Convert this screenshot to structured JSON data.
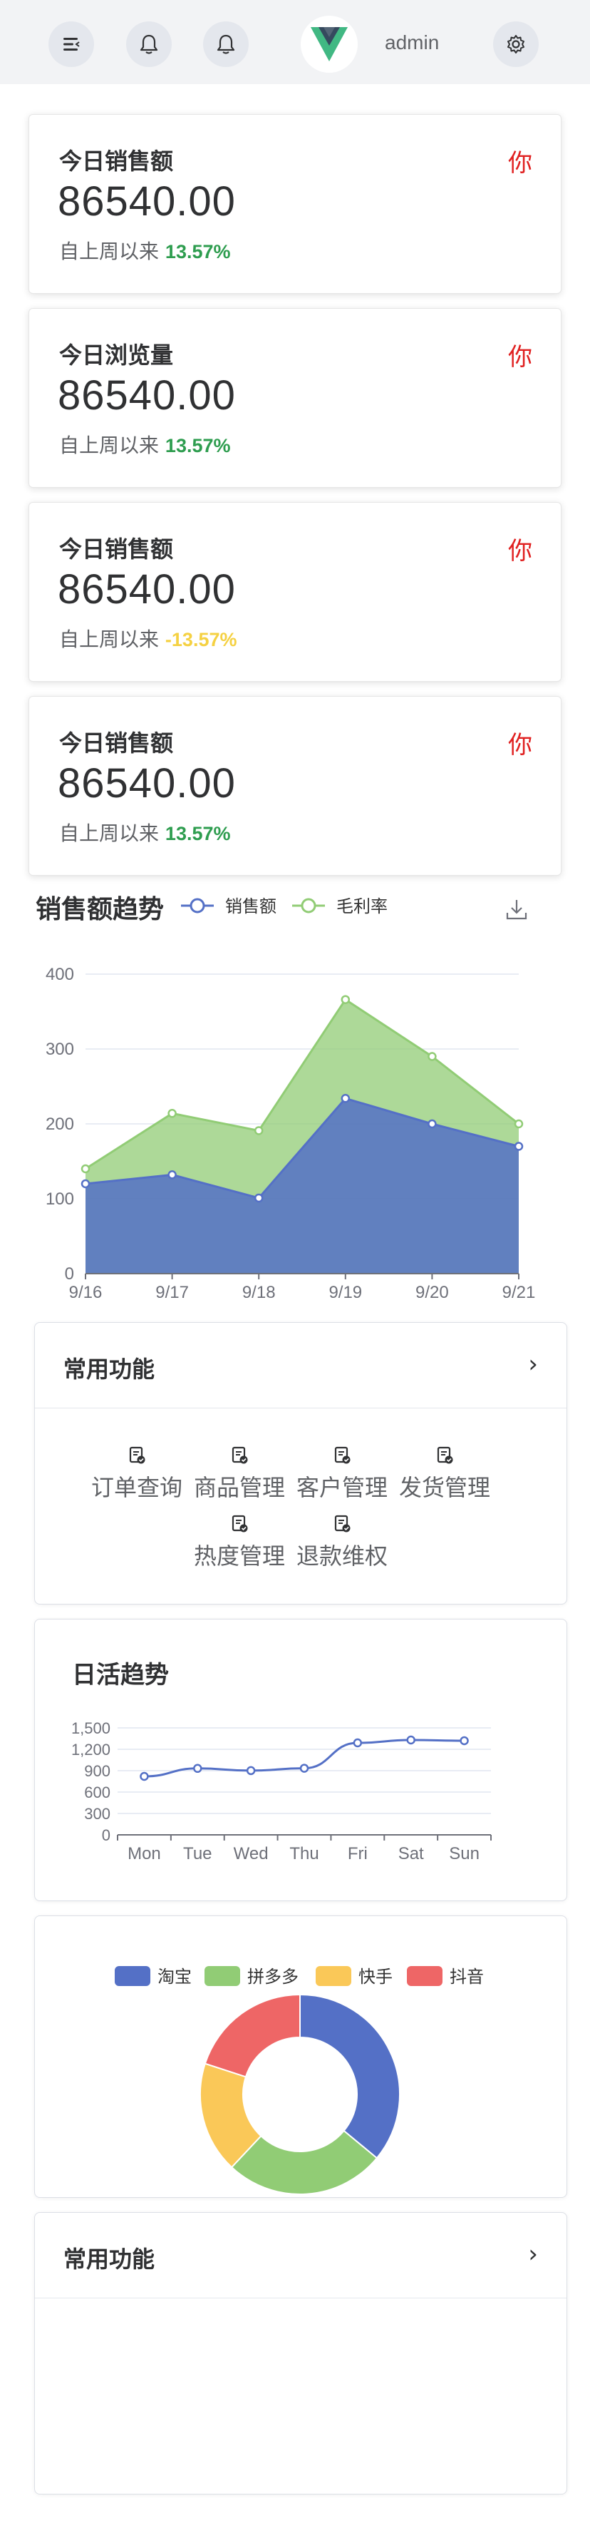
{
  "topbar": {
    "username": "admin",
    "icons": [
      "menu-icon",
      "bell-icon",
      "bell-icon",
      "vue-logo",
      "gear-icon"
    ]
  },
  "stat_cards": [
    {
      "title": "今日销售额",
      "corner": "你",
      "value": "86540.00",
      "sub_label": "自上周以来",
      "pct": "13.57%",
      "pct_color": "#2e9d4f"
    },
    {
      "title": "今日浏览量",
      "corner": "你",
      "value": "86540.00",
      "sub_label": "自上周以来",
      "pct": "13.57%",
      "pct_color": "#2e9d4f"
    },
    {
      "title": "今日销售额",
      "corner": "你",
      "value": "86540.00",
      "sub_label": "自上周以来",
      "pct": "-13.57%",
      "pct_color": "#f5d142"
    },
    {
      "title": "今日销售额",
      "corner": "你",
      "value": "86540.00",
      "sub_label": "自上周以来",
      "pct": "13.57%",
      "pct_color": "#2e9d4f"
    }
  ],
  "sales_trend": {
    "title": "销售额趋势"
  },
  "common_functions": {
    "title": "常用功能",
    "items": [
      "订单查询",
      "商品管理",
      "客户管理",
      "发货管理",
      "热度管理",
      "退款维权"
    ]
  },
  "daily_active": {
    "title": "日活趋势"
  },
  "common_functions_2": {
    "title": "常用功能"
  },
  "colors": {
    "blue": "#5470c6",
    "green": "#91cc75",
    "yellow": "#fac858",
    "red": "#ee6666",
    "grid": "#e0e6f1",
    "axis": "#6e7079"
  },
  "chart_data": [
    {
      "type": "area",
      "title": "",
      "categories": [
        "9/16",
        "9/17",
        "9/18",
        "9/19",
        "9/20",
        "9/21"
      ],
      "series": [
        {
          "name": "销售额",
          "values": [
            120,
            132,
            101,
            234,
            200,
            170
          ]
        },
        {
          "name": "毛利率",
          "values": [
            140,
            214,
            191,
            366,
            290,
            200
          ]
        }
      ],
      "ylim": [
        0,
        400
      ],
      "yticks": [
        0,
        100,
        200,
        300,
        400
      ],
      "legend": "top",
      "grid": true
    },
    {
      "type": "line",
      "title": "",
      "categories": [
        "Mon",
        "Tue",
        "Wed",
        "Thu",
        "Fri",
        "Sat",
        "Sun"
      ],
      "series": [
        {
          "values": [
            820,
            932,
            901,
            934,
            1290,
            1330,
            1320
          ]
        }
      ],
      "ylim": [
        0,
        1500
      ],
      "yticks": [
        0,
        300,
        600,
        900,
        1200,
        1500
      ],
      "ytick_labels": [
        "0",
        "300",
        "600",
        "900",
        "1,200",
        "1,500"
      ],
      "grid": true
    },
    {
      "type": "pie",
      "title": "",
      "categories": [
        "淘宝",
        "拼多多",
        "快手",
        "抖音"
      ],
      "values": [
        36,
        26,
        18,
        20
      ],
      "legend": "top"
    }
  ]
}
